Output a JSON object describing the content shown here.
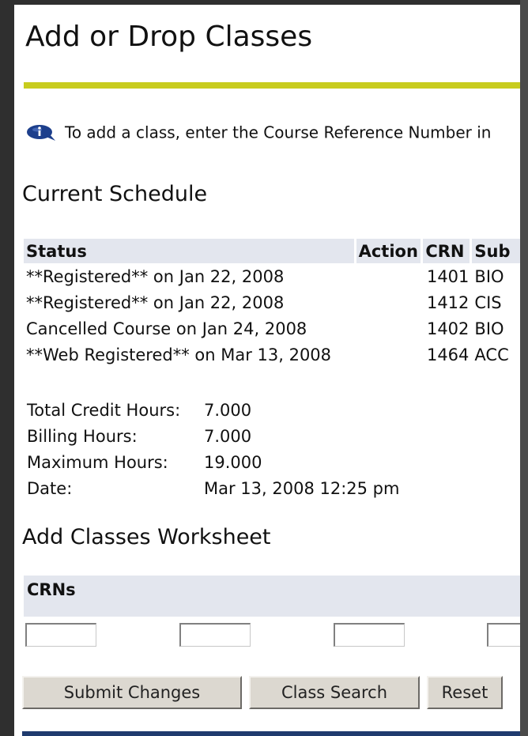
{
  "page": {
    "title": "Add or Drop Classes",
    "info_text": "To add a class, enter the Course Reference Number in"
  },
  "current_schedule": {
    "heading": "Current Schedule",
    "columns": [
      "Status",
      "Action",
      "CRN",
      "Sub"
    ],
    "rows": [
      {
        "status": "**Registered** on Jan 22, 2008",
        "action": "",
        "crn": "1401",
        "sub": "BIO"
      },
      {
        "status": "**Registered** on Jan 22, 2008",
        "action": "",
        "crn": "1412",
        "sub": "CIS"
      },
      {
        "status": "Cancelled Course on Jan 24, 2008",
        "action": "",
        "crn": "1402",
        "sub": "BIO"
      },
      {
        "status": "**Web Registered** on Mar 13, 2008",
        "action": "",
        "crn": "1464",
        "sub": "ACC"
      }
    ]
  },
  "totals": {
    "total_credit_label": "Total Credit Hours:",
    "total_credit_value": "7.000",
    "billing_label": "Billing Hours:",
    "billing_value": "7.000",
    "maximum_label": "Maximum Hours:",
    "maximum_value": "19.000",
    "date_label": "Date:",
    "date_value": "Mar 13, 2008 12:25 pm"
  },
  "worksheet": {
    "heading": "Add Classes Worksheet",
    "crns_label": "CRNs",
    "crn_values": [
      "",
      "",
      "",
      ""
    ]
  },
  "buttons": {
    "submit": "Submit Changes",
    "search": "Class Search",
    "reset": "Reset"
  },
  "colors": {
    "accent_rule": "#c8cc1e",
    "table_header_bg": "#e3e6ee",
    "footer_bar": "#1f3b6e"
  },
  "icons": {
    "info": "info-icon"
  }
}
